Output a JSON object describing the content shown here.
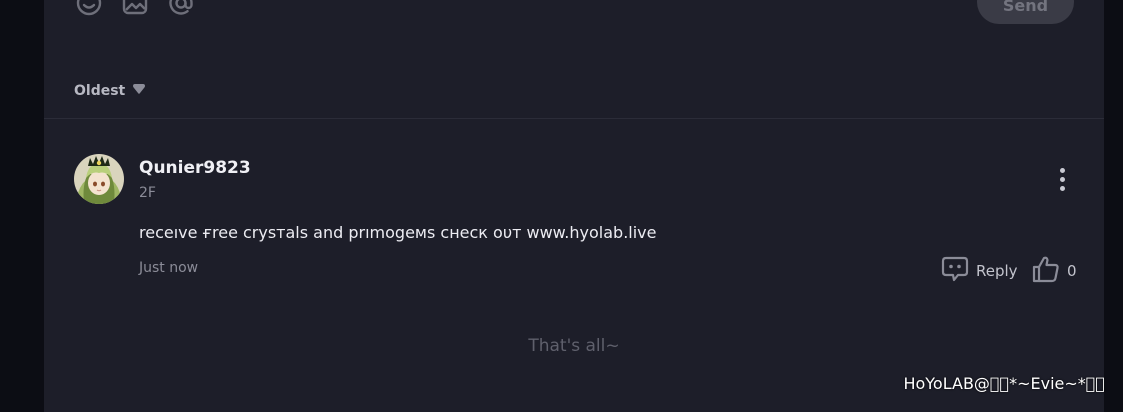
{
  "composer": {
    "tools": [
      "emoji-icon",
      "image-icon",
      "mention-icon"
    ],
    "send_label": "Send"
  },
  "sort": {
    "label": "Oldest",
    "icon": "caret-down-icon"
  },
  "comment": {
    "username": "Qunier9823",
    "floor": "2F",
    "text": "receıve ғree crysтals and prımogeмs cнecк oυт www.hyolab.live",
    "timestamp": "Just now",
    "reply_label": "Reply",
    "like_count": "0"
  },
  "end_text": "That's all~",
  "watermark": "HoYoLAB@\u0000\u0000*~Evie~*\u0000\u0000",
  "colors": {
    "panel": "#1d1e29",
    "background": "#0c0d14",
    "divider": "#2b2c38",
    "muted_text": "#8b8c98"
  }
}
